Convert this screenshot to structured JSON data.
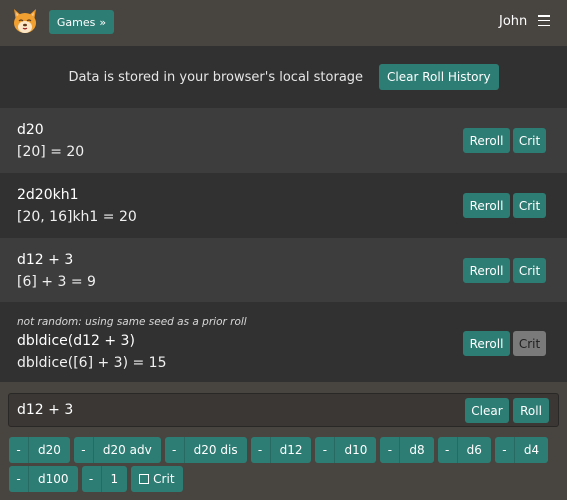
{
  "header": {
    "logo": "corgi-logo",
    "games_label": "Games",
    "games_icon": "double-chevron-right-icon",
    "user_name": "John",
    "menu_icon": "hamburger-menu-icon"
  },
  "info_bar": {
    "text": "Data is stored in your browser's local storage",
    "clear_history_label": "Clear Roll History"
  },
  "rolls": [
    {
      "note": "",
      "expression": "d20",
      "result": "[20] = 20",
      "reroll_label": "Reroll",
      "crit_label": "Crit",
      "crit_enabled": true
    },
    {
      "note": "",
      "expression": "2d20kh1",
      "result": "[20, 16]kh1 = 20",
      "reroll_label": "Reroll",
      "crit_label": "Crit",
      "crit_enabled": true
    },
    {
      "note": "",
      "expression": "d12 + 3",
      "result": "[6] + 3 = 9",
      "reroll_label": "Reroll",
      "crit_label": "Crit",
      "crit_enabled": true
    },
    {
      "note": "not random: using same seed as a prior roll",
      "expression": "dbldice(d12 + 3)",
      "result": "dbldice([6] + 3) = 15",
      "reroll_label": "Reroll",
      "crit_label": "Crit",
      "crit_enabled": false
    }
  ],
  "input": {
    "value": "d12 + 3",
    "clear_label": "Clear",
    "roll_label": "Roll"
  },
  "dice_buttons": [
    {
      "minus": "-",
      "label": "d20"
    },
    {
      "minus": "-",
      "label": "d20 adv"
    },
    {
      "minus": "-",
      "label": "d20 dis"
    },
    {
      "minus": "-",
      "label": "d12"
    },
    {
      "minus": "-",
      "label": "d10"
    },
    {
      "minus": "-",
      "label": "d8"
    },
    {
      "minus": "-",
      "label": "d6"
    },
    {
      "minus": "-",
      "label": "d4"
    },
    {
      "minus": "-",
      "label": "d100"
    },
    {
      "minus": "-",
      "label": "1"
    }
  ],
  "crit_toggle": {
    "label": "Crit",
    "checked": false
  },
  "colors": {
    "accent": "#2e7d74",
    "disabled": "#7a7a7a",
    "background": "#484440"
  }
}
